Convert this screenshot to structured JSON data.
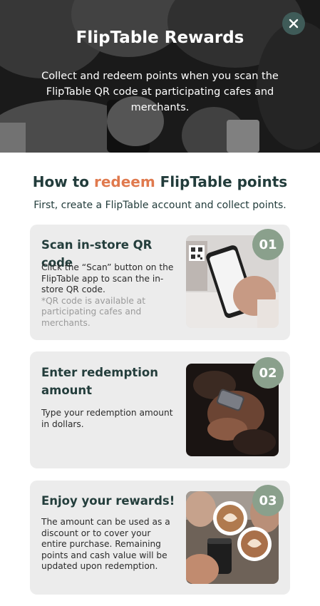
{
  "header": {
    "title": "FlipTable Rewards",
    "subtitle": "Collect and redeem points when you scan the FlipTable QR code at participating cafes and merchants.",
    "close_icon": "close-icon"
  },
  "section": {
    "heading_before": "How to ",
    "heading_accent": "redeem",
    "heading_after": " FlipTable points",
    "intro": "First, create a FlipTable account and collect points."
  },
  "steps": [
    {
      "number": "01",
      "title": "Scan in-store QR code",
      "text": "Click the “Scan” button on the FlipTable app to scan the in-store QR code.",
      "note": "*QR code is available at participating cafes and merchants."
    },
    {
      "number": "02",
      "title": "Enter redemption amount",
      "text": "Type your redemption amount in dollars."
    },
    {
      "number": "03",
      "title": "Enjoy your rewards!",
      "text": "The amount can be used as a discount or to cover your entire purchase. Remaining points and cash value will be updated upon redemption."
    }
  ],
  "colors": {
    "accent": "#e07a4e",
    "badge": "#8aa08c",
    "close_button": "#3f5b58",
    "heading": "#223c3b",
    "card_bg": "#ececec"
  }
}
